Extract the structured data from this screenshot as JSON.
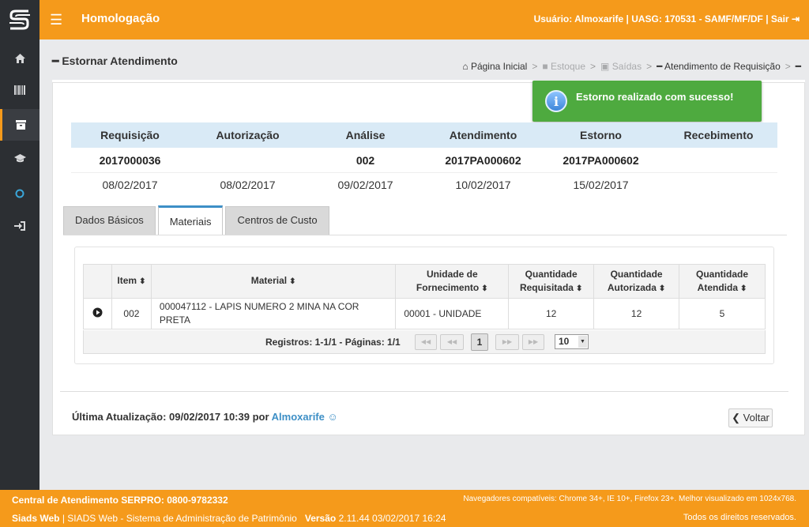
{
  "header": {
    "title": "Homologação",
    "user_info": "Usuário: Almoxarife | UASG: 170531 - SAMF/MF/DF | Sair",
    "colors": {
      "brand": "#f59a1b",
      "sidebar": "#2c2f33"
    }
  },
  "sidebar": {
    "items": [
      {
        "icon": "home-icon"
      },
      {
        "icon": "barcode-icon"
      },
      {
        "icon": "archive-icon"
      },
      {
        "icon": "graduation-cap-icon"
      },
      {
        "icon": "circle-icon"
      },
      {
        "icon": "sign-in-icon"
      }
    ]
  },
  "page": {
    "title": "Estornar Atendimento",
    "breadcrumb": [
      "Página Inicial",
      "Estoque",
      "Saídas",
      "Atendimento de Requisição"
    ]
  },
  "status_badge": "do",
  "toast": {
    "message": "Estorno realizado com sucesso!"
  },
  "summary": {
    "headers": [
      "Requisição",
      "Autorização",
      "Análise",
      "Atendimento",
      "Estorno",
      "Recebimento"
    ],
    "codes": [
      "2017000036",
      "",
      "002",
      "2017PA000602",
      "2017PA000602",
      ""
    ],
    "dates": [
      "08/02/2017",
      "08/02/2017",
      "09/02/2017",
      "10/02/2017",
      "15/02/2017",
      ""
    ]
  },
  "tabs": [
    "Dados Básicos",
    "Materiais",
    "Centros de Custo"
  ],
  "grid": {
    "headers": {
      "item": "Item",
      "material": "Material",
      "unidade_1": "Unidade de",
      "unidade_2": "Fornecimento",
      "qr_1": "Quantidade",
      "qr_2": "Requisitada",
      "qa_1": "Quantidade",
      "qa_2": "Autorizada",
      "qat_1": "Quantidade",
      "qat_2": "Atendida"
    },
    "rows": [
      {
        "item": "002",
        "material_1": "000047112 - LAPIS NUMERO 2 MINA NA COR",
        "material_2": "PRETA",
        "unidade": "00001 - UNIDADE",
        "requisitada": "12",
        "autorizada": "12",
        "atendida": "5"
      }
    ],
    "pager": {
      "info": "Registros: 1-1/1 - Páginas: 1/1",
      "current_page": "1",
      "page_size": "10"
    }
  },
  "footer_info": {
    "last_update_label": "Última Atualização: 09/02/2017 10:39 por",
    "last_update_user": "Almoxarife",
    "back_label": "Voltar"
  },
  "footer": {
    "support": "Central de Atendimento SERPRO: 0800-9782332",
    "browsers": "Navegadores compatíveis: Chrome 34+, IE 10+, Firefox 23+. Melhor visualizado em 1024x768.",
    "system_name": "Siads Web",
    "system_desc": "| SIADS Web - Sistema de Administração de Patrimônio",
    "version_label": "Versão",
    "version_value": "2.11.44 03/02/2017 16:24",
    "rights": "Todos os direitos reservados."
  }
}
